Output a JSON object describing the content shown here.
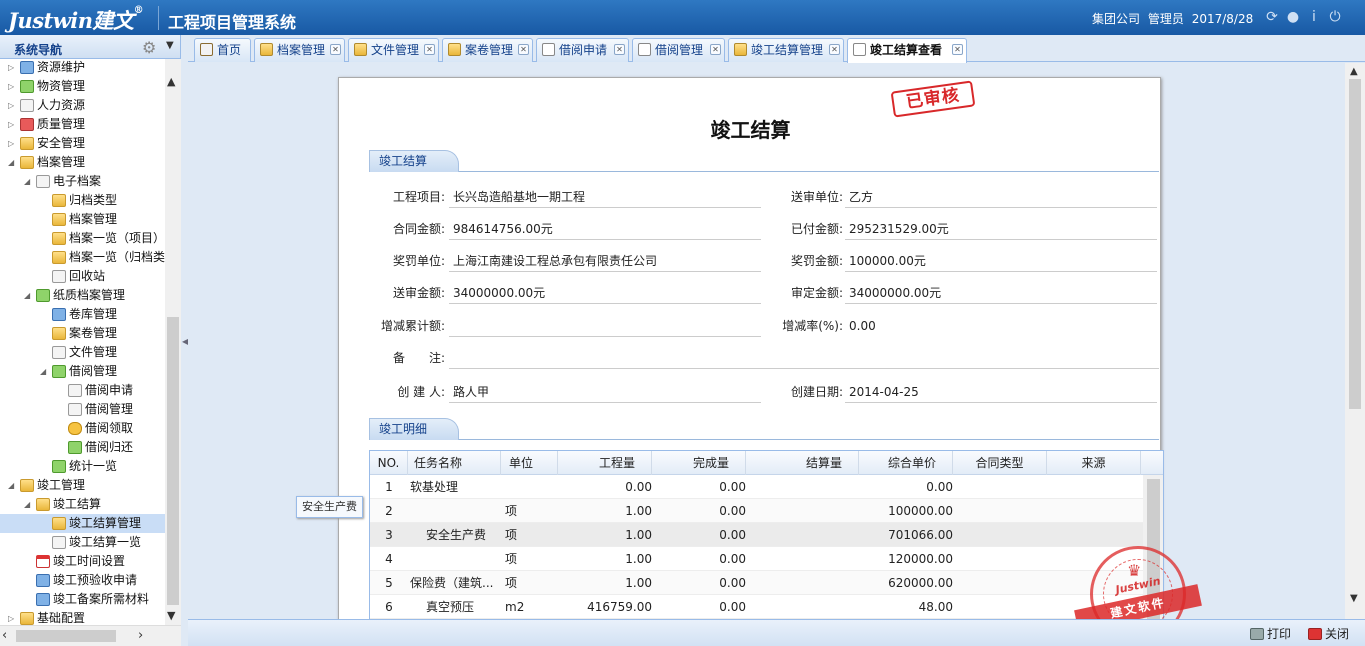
{
  "header": {
    "logo_text": "Justwin建文",
    "logo_mark": "®",
    "app_title": "工程项目管理系统",
    "company": "集团公司",
    "user": "管理员",
    "date": "2017/8/28",
    "icons": [
      "refresh-icon",
      "user-icon",
      "info-icon",
      "power-icon"
    ]
  },
  "sidebar": {
    "title": "系统导航",
    "items": [
      {
        "label": "资源维护"
      },
      {
        "label": "物资管理"
      },
      {
        "label": "人力资源"
      },
      {
        "label": "质量管理"
      },
      {
        "label": "安全管理"
      },
      {
        "label": "档案管理"
      },
      {
        "label": "电子档案"
      },
      {
        "label": "归档类型"
      },
      {
        "label": "档案管理"
      },
      {
        "label": "档案一览（项目）"
      },
      {
        "label": "档案一览（归档类"
      },
      {
        "label": "回收站"
      },
      {
        "label": "纸质档案管理"
      },
      {
        "label": "卷库管理"
      },
      {
        "label": "案卷管理"
      },
      {
        "label": "文件管理"
      },
      {
        "label": "借阅管理"
      },
      {
        "label": "借阅申请"
      },
      {
        "label": "借阅管理"
      },
      {
        "label": "借阅领取"
      },
      {
        "label": "借阅归还"
      },
      {
        "label": "统计一览"
      },
      {
        "label": "竣工管理"
      },
      {
        "label": "竣工结算"
      },
      {
        "label": "竣工结算管理"
      },
      {
        "label": "竣工结算一览"
      },
      {
        "label": "竣工时间设置"
      },
      {
        "label": "竣工预验收申请"
      },
      {
        "label": "竣工备案所需材料"
      },
      {
        "label": "基础配置"
      }
    ]
  },
  "tabs": [
    {
      "label": "首页"
    },
    {
      "label": "档案管理"
    },
    {
      "label": "文件管理"
    },
    {
      "label": "案卷管理"
    },
    {
      "label": "借阅申请"
    },
    {
      "label": "借阅管理"
    },
    {
      "label": "竣工结算管理"
    },
    {
      "label": "竣工结算查看"
    }
  ],
  "document": {
    "stamp": "已审核",
    "title": "竣工结算",
    "section1": "竣工结算",
    "fields": {
      "project_label": "工程项目:",
      "project": "长兴岛造船基地一期工程",
      "submitter_label": "送审单位:",
      "submitter": "乙方",
      "contract_amount_label": "合同金额:",
      "contract_amount": "984614756.00元",
      "paid_amount_label": "已付金额:",
      "paid_amount": "295231529.00元",
      "reward_unit_label": "奖罚单位:",
      "reward_unit": "上海江南建设工程总承包有限责任公司",
      "reward_amount_label": "奖罚金额:",
      "reward_amount": "100000.00元",
      "submit_amount_label": "送审金额:",
      "submit_amount": "34000000.00元",
      "approved_amount_label": "审定金额:",
      "approved_amount": "34000000.00元",
      "cumulative_label": "增减累计额:",
      "cumulative": "",
      "rate_label": "增减率(%):",
      "rate": "0.00",
      "remark_label": "备　　注:",
      "remark": "",
      "creator_label": "创 建 人:",
      "creator": "路人甲",
      "created_label": "创建日期:",
      "created": "2014-04-25"
    },
    "section2": "竣工明细",
    "grid": {
      "columns": [
        "NO.",
        "任务名称",
        "单位",
        "工程量",
        "完成量",
        "结算量",
        "综合单价",
        "合同类型",
        "来源"
      ],
      "rows": [
        {
          "no": "1",
          "name": "软基处理",
          "unit": "",
          "qty": "0.00",
          "done": "0.00",
          "settle": "",
          "price": "0.00"
        },
        {
          "no": "2",
          "name": "",
          "unit": "项",
          "qty": "1.00",
          "done": "0.00",
          "settle": "",
          "price": "100000.00"
        },
        {
          "no": "3",
          "name": "安全生产费",
          "unit": "项",
          "qty": "1.00",
          "done": "0.00",
          "settle": "",
          "price": "701066.00"
        },
        {
          "no": "4",
          "name": "",
          "unit": "项",
          "qty": "1.00",
          "done": "0.00",
          "settle": "",
          "price": "120000.00"
        },
        {
          "no": "5",
          "name": "保险费（建筑...",
          "unit": "项",
          "qty": "1.00",
          "done": "0.00",
          "settle": "",
          "price": "620000.00"
        },
        {
          "no": "6",
          "name": "真空预压",
          "unit": "m2",
          "qty": "416759.00",
          "done": "0.00",
          "settle": "",
          "price": "48.00"
        }
      ]
    },
    "tooltip": "安全生产费"
  },
  "seal": {
    "brand": "Justwin",
    "ribbon": "建文软件"
  },
  "footer": {
    "print": "打印",
    "close": "关闭"
  },
  "colors": {
    "header": "#1f64ae",
    "stamp": "#d8282a",
    "accent": "#15428b"
  }
}
